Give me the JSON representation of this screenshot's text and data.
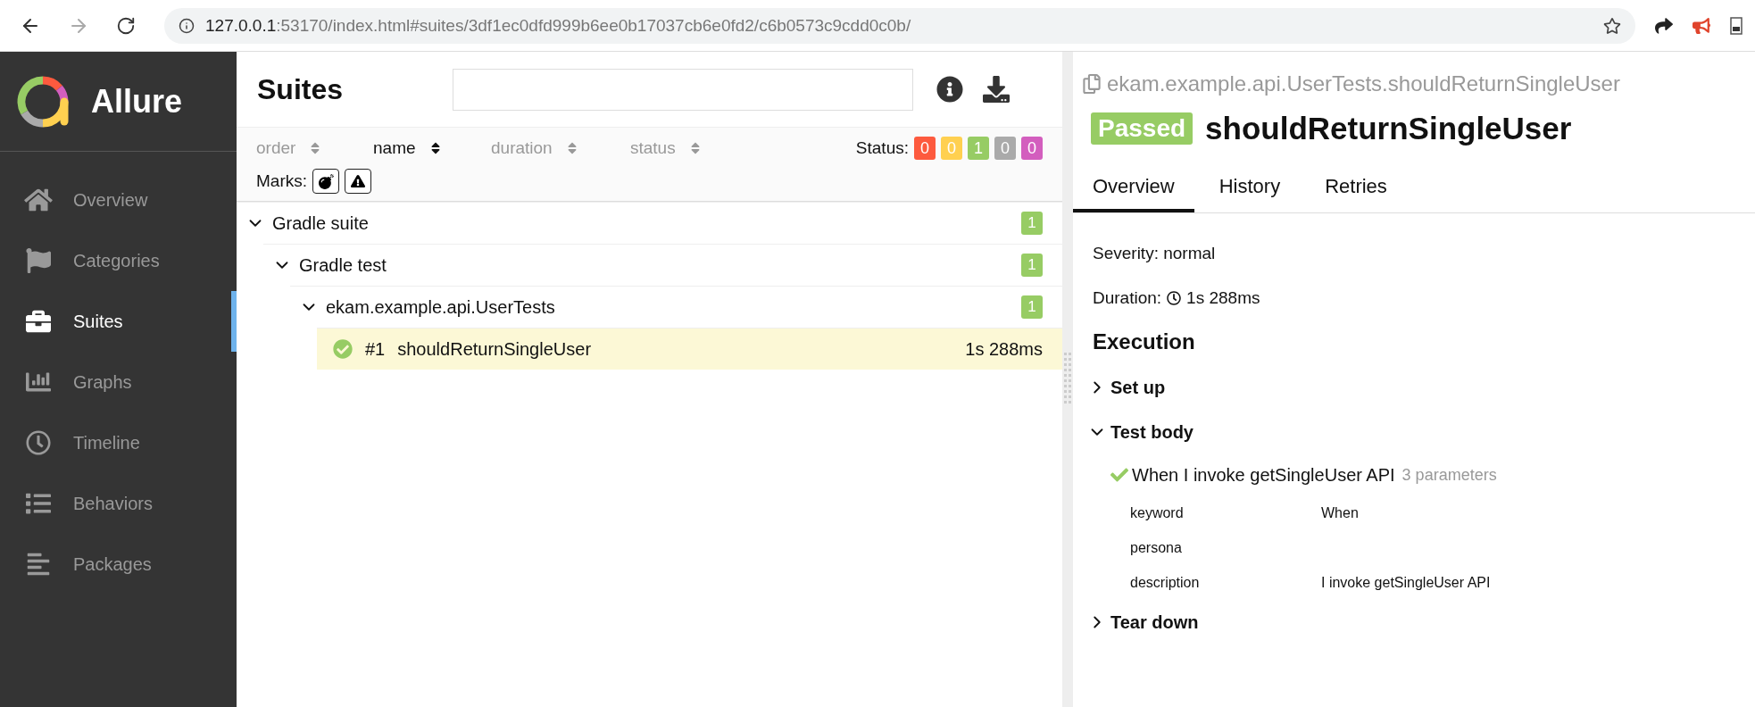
{
  "browser": {
    "url_host": "127.0.0.1",
    "url_rest": ":53170/index.html#suites/3df1ec0dfd999b6ee0b17037cb6e0fd2/c6b0573c9cdd0c0b/"
  },
  "sidebar": {
    "brand": "Allure",
    "items": [
      {
        "label": "Overview",
        "kind": "home",
        "selected": false
      },
      {
        "label": "Categories",
        "kind": "flag",
        "selected": false
      },
      {
        "label": "Suites",
        "kind": "briefcase",
        "selected": true
      },
      {
        "label": "Graphs",
        "kind": "chart",
        "selected": false
      },
      {
        "label": "Timeline",
        "kind": "clock",
        "selected": false
      },
      {
        "label": "Behaviors",
        "kind": "list",
        "selected": false
      },
      {
        "label": "Packages",
        "kind": "packages",
        "selected": false
      }
    ]
  },
  "suites": {
    "title": "Suites",
    "sorters": [
      {
        "label": "order",
        "selected": false
      },
      {
        "label": "name",
        "selected": true
      },
      {
        "label": "duration",
        "selected": false
      },
      {
        "label": "status",
        "selected": false
      }
    ],
    "status_label": "Status:",
    "status_counts": [
      {
        "count": "0",
        "color": "#fd5a3e"
      },
      {
        "count": "0",
        "color": "#ffd050"
      },
      {
        "count": "1",
        "color": "#97cc64"
      },
      {
        "count": "0",
        "color": "#aaaaaa"
      },
      {
        "count": "0",
        "color": "#d35ebe"
      }
    ],
    "marks_label": "Marks:",
    "marks": [
      {
        "kind": "flaky"
      },
      {
        "kind": "known"
      }
    ],
    "tree": [
      {
        "kind": "group",
        "name": "Gradle suite",
        "expanded": true,
        "count": "1",
        "children": [
          {
            "kind": "group",
            "name": "Gradle test",
            "expanded": true,
            "count": "1",
            "children": [
              {
                "kind": "group",
                "name": "ekam.example.api.UserTests",
                "expanded": true,
                "count": "1",
                "children": [
                  {
                    "kind": "test",
                    "order": "#1",
                    "name": "shouldReturnSingleUser",
                    "duration": "1s 288ms",
                    "selected": true
                  }
                ]
              }
            ]
          }
        ]
      }
    ]
  },
  "details": {
    "path": "ekam.example.api.UserTests.shouldReturnSingleUser",
    "badge": {
      "kind": "passed",
      "label": "Passed"
    },
    "title": "shouldReturnSingleUser",
    "tabs": [
      {
        "label": "Overview",
        "selected": true
      },
      {
        "label": "History",
        "selected": false
      },
      {
        "label": "Retries",
        "selected": false
      }
    ],
    "severity": "Severity: normal",
    "duration_label": "Duration:",
    "duration": "1s 288ms",
    "execution_title": "Execution",
    "sections": [
      {
        "title": "Set up",
        "expanded": false
      },
      {
        "title": "Test body",
        "expanded": true,
        "steps": [
          {
            "name": "When I invoke getSingleUser API",
            "params_label": "3 parameters",
            "parameters": [
              {
                "name": "keyword",
                "value": "When"
              },
              {
                "name": "persona"
              },
              {
                "name": "description",
                "value": "I invoke getSingleUser API"
              }
            ]
          }
        ]
      },
      {
        "title": "Tear down",
        "expanded": false
      }
    ]
  }
}
